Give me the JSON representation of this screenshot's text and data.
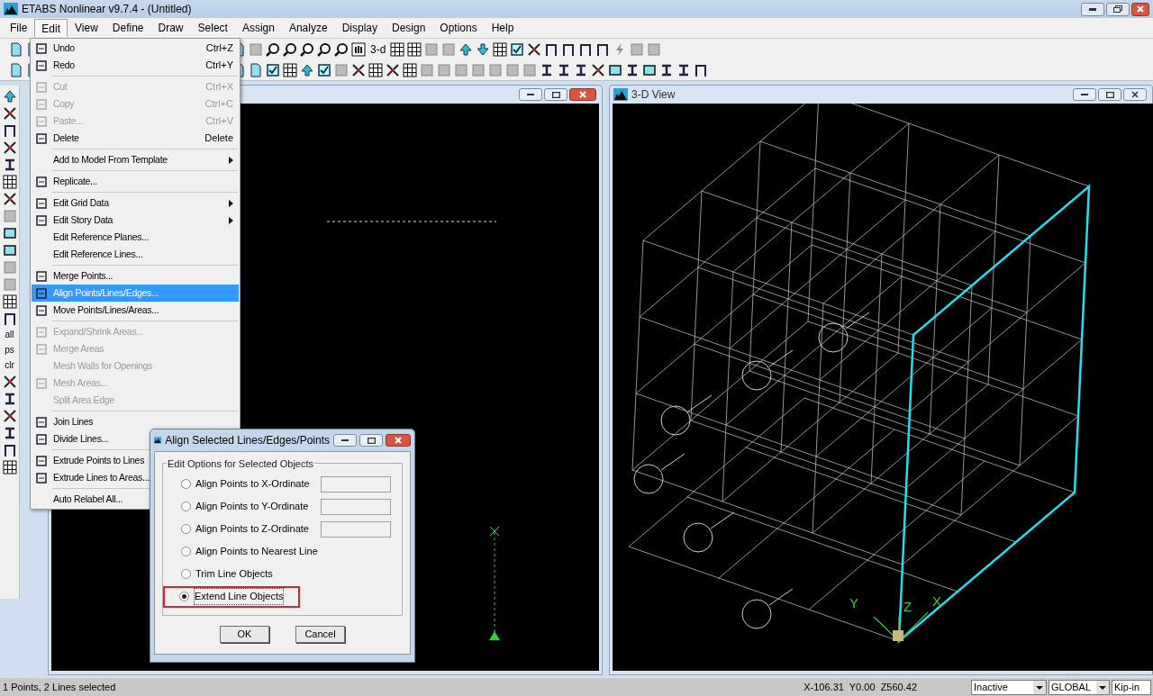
{
  "window": {
    "title": "ETABS Nonlinear v9.7.4 - (Untitled)"
  },
  "menu": [
    {
      "label": "File",
      "selected": false
    },
    {
      "label": "Edit",
      "selected": true
    },
    {
      "label": "View",
      "selected": false
    },
    {
      "label": "Define",
      "selected": false
    },
    {
      "label": "Draw",
      "selected": false
    },
    {
      "label": "Select",
      "selected": false
    },
    {
      "label": "Assign",
      "selected": false
    },
    {
      "label": "Analyze",
      "selected": false
    },
    {
      "label": "Display",
      "selected": false
    },
    {
      "label": "Design",
      "selected": false
    },
    {
      "label": "Options",
      "selected": false
    },
    {
      "label": "Help",
      "selected": false
    }
  ],
  "toolbar": {
    "label": "3-d"
  },
  "side_toolbar": {
    "labels": [
      "all",
      "ps",
      "clr"
    ]
  },
  "edit_menu": [
    {
      "kind": "item",
      "label": "Undo",
      "shortcut": "Ctrl+Z",
      "disabled": false,
      "selected": false,
      "icon": true
    },
    {
      "kind": "item",
      "label": "Redo",
      "shortcut": "Ctrl+Y",
      "disabled": false,
      "selected": false,
      "icon": true
    },
    {
      "kind": "separator"
    },
    {
      "kind": "item",
      "label": "Cut",
      "shortcut": "Ctrl+X",
      "disabled": true,
      "selected": false,
      "icon": true
    },
    {
      "kind": "item",
      "label": "Copy",
      "shortcut": "Ctrl+C",
      "disabled": true,
      "selected": false,
      "icon": true
    },
    {
      "kind": "item",
      "label": "Paste...",
      "shortcut": "Ctrl+V",
      "disabled": true,
      "selected": false,
      "icon": true
    },
    {
      "kind": "item",
      "label": "Delete",
      "shortcut": "Delete",
      "disabled": false,
      "selected": false,
      "icon": true
    },
    {
      "kind": "separator"
    },
    {
      "kind": "item",
      "label": "Add to Model From Template",
      "disabled": false,
      "selected": false,
      "submenu": true,
      "icon": false
    },
    {
      "kind": "separator"
    },
    {
      "kind": "item",
      "label": "Replicate...",
      "disabled": false,
      "selected": false,
      "icon": true
    },
    {
      "kind": "separator"
    },
    {
      "kind": "item",
      "label": "Edit Grid Data",
      "disabled": false,
      "selected": false,
      "submenu": true,
      "icon": true
    },
    {
      "kind": "item",
      "label": "Edit Story Data",
      "disabled": false,
      "selected": false,
      "submenu": true,
      "icon": true
    },
    {
      "kind": "item",
      "label": "Edit Reference Planes...",
      "disabled": false,
      "selected": false,
      "icon": false
    },
    {
      "kind": "item",
      "label": "Edit Reference Lines...",
      "disabled": false,
      "selected": false,
      "icon": false
    },
    {
      "kind": "separator"
    },
    {
      "kind": "item",
      "label": "Merge Points...",
      "disabled": false,
      "selected": false,
      "icon": true
    },
    {
      "kind": "item",
      "label": "Align Points/Lines/Edges...",
      "disabled": false,
      "selected": true,
      "icon": true
    },
    {
      "kind": "item",
      "label": "Move Points/Lines/Areas...",
      "disabled": false,
      "selected": false,
      "icon": true
    },
    {
      "kind": "separator"
    },
    {
      "kind": "item",
      "label": "Expand/Shrink Areas...",
      "disabled": true,
      "selected": false,
      "icon": true
    },
    {
      "kind": "item",
      "label": "Merge Areas",
      "disabled": true,
      "selected": false,
      "icon": true
    },
    {
      "kind": "item",
      "label": "Mesh Walls for Openings",
      "disabled": true,
      "selected": false,
      "icon": false
    },
    {
      "kind": "item",
      "label": "Mesh Areas...",
      "disabled": true,
      "selected": false,
      "icon": true
    },
    {
      "kind": "item",
      "label": "Split Area Edge",
      "disabled": true,
      "selected": false,
      "icon": false
    },
    {
      "kind": "separator"
    },
    {
      "kind": "item",
      "label": "Join Lines",
      "disabled": false,
      "selected": false,
      "icon": true
    },
    {
      "kind": "item",
      "label": "Divide Lines...",
      "disabled": false,
      "selected": false,
      "icon": true
    },
    {
      "kind": "separator"
    },
    {
      "kind": "item",
      "label": "Extrude Points to Lines",
      "disabled": false,
      "selected": false,
      "icon": true
    },
    {
      "kind": "item",
      "label": "Extrude Lines to Areas...",
      "disabled": false,
      "selected": false,
      "icon": true
    },
    {
      "kind": "separator"
    },
    {
      "kind": "item",
      "label": "Auto Relabel All...",
      "disabled": false,
      "selected": false,
      "icon": false
    }
  ],
  "view_3d": {
    "title": "3-D View",
    "axis_labels": [
      "Y",
      "Z",
      "X"
    ]
  },
  "dialog": {
    "title": "Align Selected Lines/Edges/Points",
    "group": "Edit Options for Selected Objects",
    "options": [
      {
        "label": "Align Points to X-Ordinate",
        "selected": false,
        "field": true,
        "highlighted": false
      },
      {
        "label": "Align Points to Y-Ordinate",
        "selected": false,
        "field": true,
        "highlighted": false
      },
      {
        "label": "Align Points to Z-Ordinate",
        "selected": false,
        "field": true,
        "highlighted": false
      },
      {
        "label": "Align Points to Nearest Line",
        "selected": false,
        "field": false,
        "highlighted": false
      },
      {
        "label": "Trim Line Objects",
        "selected": false,
        "field": false,
        "highlighted": false
      },
      {
        "label": "Extend Line Objects",
        "selected": true,
        "field": false,
        "highlighted": true
      }
    ],
    "buttons": [
      "OK",
      "Cancel"
    ]
  },
  "status_bar": {
    "message": "1 Points, 2 Lines selected",
    "coordinates": "X-106.31  Y0.00  Z560.42",
    "dropdowns": [
      "Inactive",
      "GLOBAL",
      "Kip-in"
    ]
  }
}
